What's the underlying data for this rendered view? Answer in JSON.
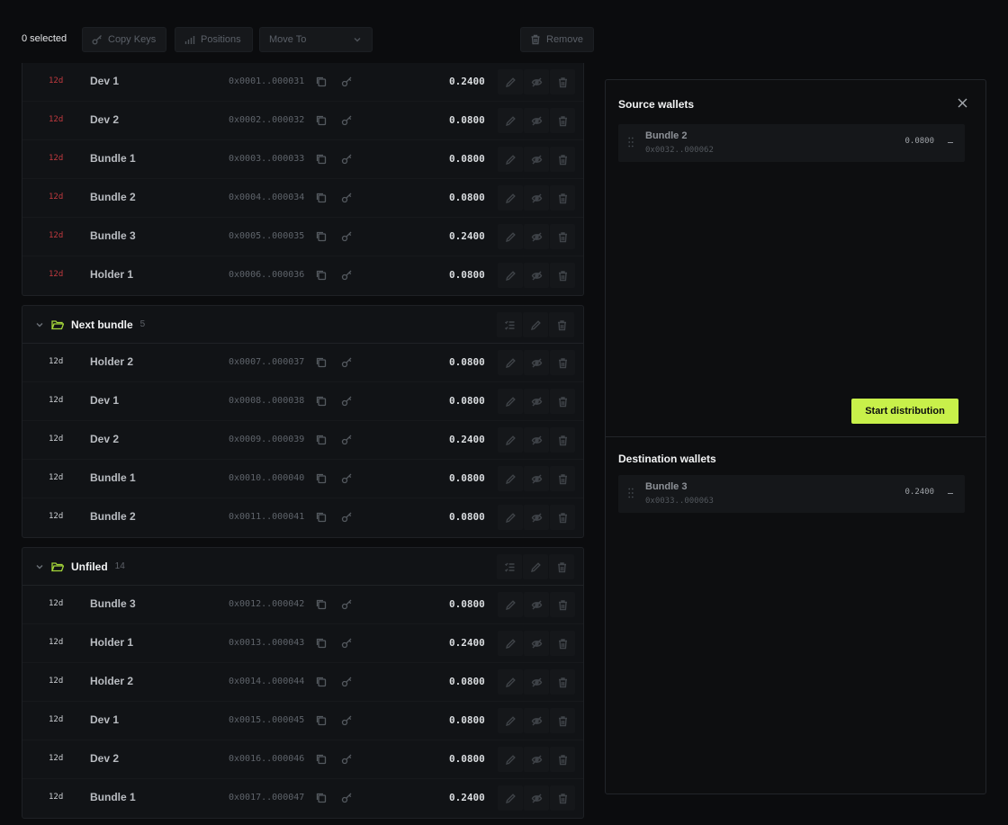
{
  "toolbar": {
    "selected": "0 selected",
    "copy_keys": "Copy Keys",
    "positions": "Positions",
    "move_to": "Move To",
    "remove": "Remove"
  },
  "groups": [
    {
      "name": "",
      "count": "",
      "rows": [
        {
          "age": "12d",
          "name": "Dev 1",
          "address": "0x0001..000031",
          "balance": "0.2400"
        },
        {
          "age": "12d",
          "name": "Dev 2",
          "address": "0x0002..000032",
          "balance": "0.0800"
        },
        {
          "age": "12d",
          "name": "Bundle 1",
          "address": "0x0003..000033",
          "balance": "0.0800"
        },
        {
          "age": "12d",
          "name": "Bundle 2",
          "address": "0x0004..000034",
          "balance": "0.0800"
        },
        {
          "age": "12d",
          "name": "Bundle 3",
          "address": "0x0005..000035",
          "balance": "0.2400"
        },
        {
          "age": "12d",
          "name": "Holder 1",
          "address": "0x0006..000036",
          "balance": "0.0800"
        }
      ]
    },
    {
      "name": "Next bundle",
      "count": "5",
      "rows": [
        {
          "age": "12d",
          "name": "Holder 2",
          "address": "0x0007..000037",
          "balance": "0.0800"
        },
        {
          "age": "12d",
          "name": "Dev 1",
          "address": "0x0008..000038",
          "balance": "0.0800"
        },
        {
          "age": "12d",
          "name": "Dev 2",
          "address": "0x0009..000039",
          "balance": "0.2400"
        },
        {
          "age": "12d",
          "name": "Bundle 1",
          "address": "0x0010..000040",
          "balance": "0.0800"
        },
        {
          "age": "12d",
          "name": "Bundle 2",
          "address": "0x0011..000041",
          "balance": "0.0800"
        }
      ]
    },
    {
      "name": "Unfiled",
      "count": "14",
      "rows": [
        {
          "age": "12d",
          "name": "Bundle 3",
          "address": "0x0012..000042",
          "balance": "0.0800"
        },
        {
          "age": "12d",
          "name": "Holder 1",
          "address": "0x0013..000043",
          "balance": "0.2400"
        },
        {
          "age": "12d",
          "name": "Holder 2",
          "address": "0x0014..000044",
          "balance": "0.0800"
        },
        {
          "age": "12d",
          "name": "Dev 1",
          "address": "0x0015..000045",
          "balance": "0.0800"
        },
        {
          "age": "12d",
          "name": "Dev 2",
          "address": "0x0016..000046",
          "balance": "0.0800"
        },
        {
          "age": "12d",
          "name": "Bundle 1",
          "address": "0x0017..000047",
          "balance": "0.2400"
        }
      ]
    }
  ],
  "panel": {
    "source_title": "Source wallets",
    "source_wallet": {
      "name": "Bundle 2",
      "address": "0x0032..000062",
      "balance": "0.0800"
    },
    "start_button": "Start distribution",
    "destination_title": "Destination wallets",
    "destination_wallet": {
      "name": "Bundle 3",
      "address": "0x0033..000063",
      "balance": "0.2400"
    }
  },
  "colors": {
    "accent": "#c8f04a",
    "age_alert": "#c23a3f",
    "folder": "#a5d63a",
    "background": "#0b0c0e"
  }
}
